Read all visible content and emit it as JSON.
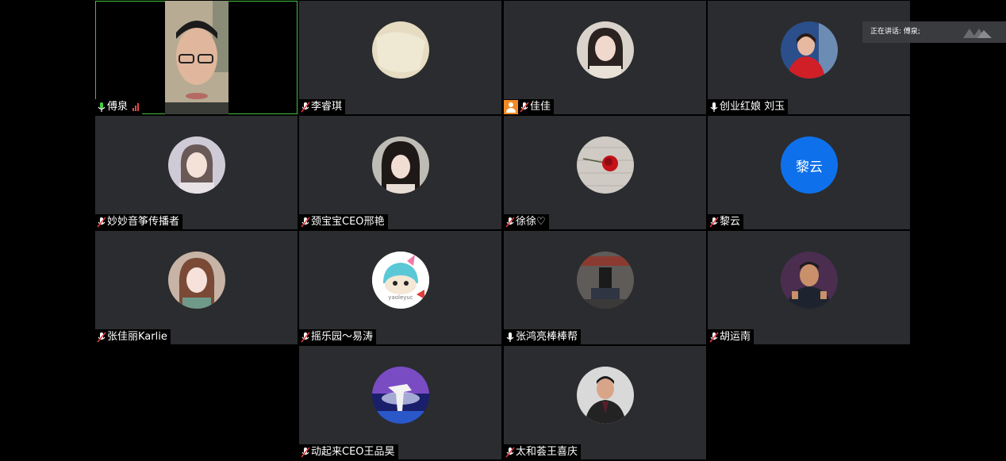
{
  "speaker_banner": {
    "text": "正在讲话: 傅泉;"
  },
  "participants": [
    {
      "name": "傅泉"
    },
    {
      "name": "李睿琪"
    },
    {
      "name": "佳佳"
    },
    {
      "name": "创业红娘 刘玉"
    },
    {
      "name": "妙妙音筝传播者"
    },
    {
      "name": "颈宝宝CEO邢艳"
    },
    {
      "name": "徐徐♡"
    },
    {
      "name": "黎云",
      "initials": "黎云"
    },
    {
      "name": "张佳丽Karlie"
    },
    {
      "name": "摇乐园～易涛",
      "avatar_text": "yaoleyuc"
    },
    {
      "name": "张鸿亮棒棒帮"
    },
    {
      "name": "胡运南"
    },
    {
      "name": "动起来CEO王品昊"
    },
    {
      "name": "太和荟王喜庆"
    }
  ],
  "colors": {
    "active_border": "#3fbf3f",
    "host_badge": "#f08a24",
    "initials_bg": "#0e71eb",
    "tile_bg": "#2b2c2f"
  }
}
